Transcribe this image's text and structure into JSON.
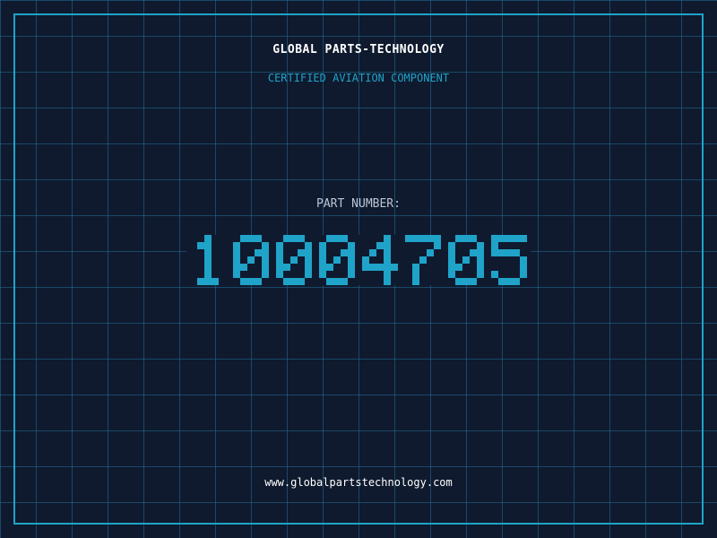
{
  "header": {
    "company_name": "GLOBAL PARTS-TECHNOLOGY",
    "subtitle": "CERTIFIED AVIATION COMPONENT"
  },
  "part": {
    "label": "PART NUMBER:",
    "number": "10004705"
  },
  "footer": {
    "website": "www.globalpartstechnology.com"
  },
  "colors": {
    "background": "#0f1a2e",
    "grid": "#226e96",
    "accent": "#1fa3c9",
    "title_text": "#ffffff",
    "label_text": "#b9c6d6"
  }
}
